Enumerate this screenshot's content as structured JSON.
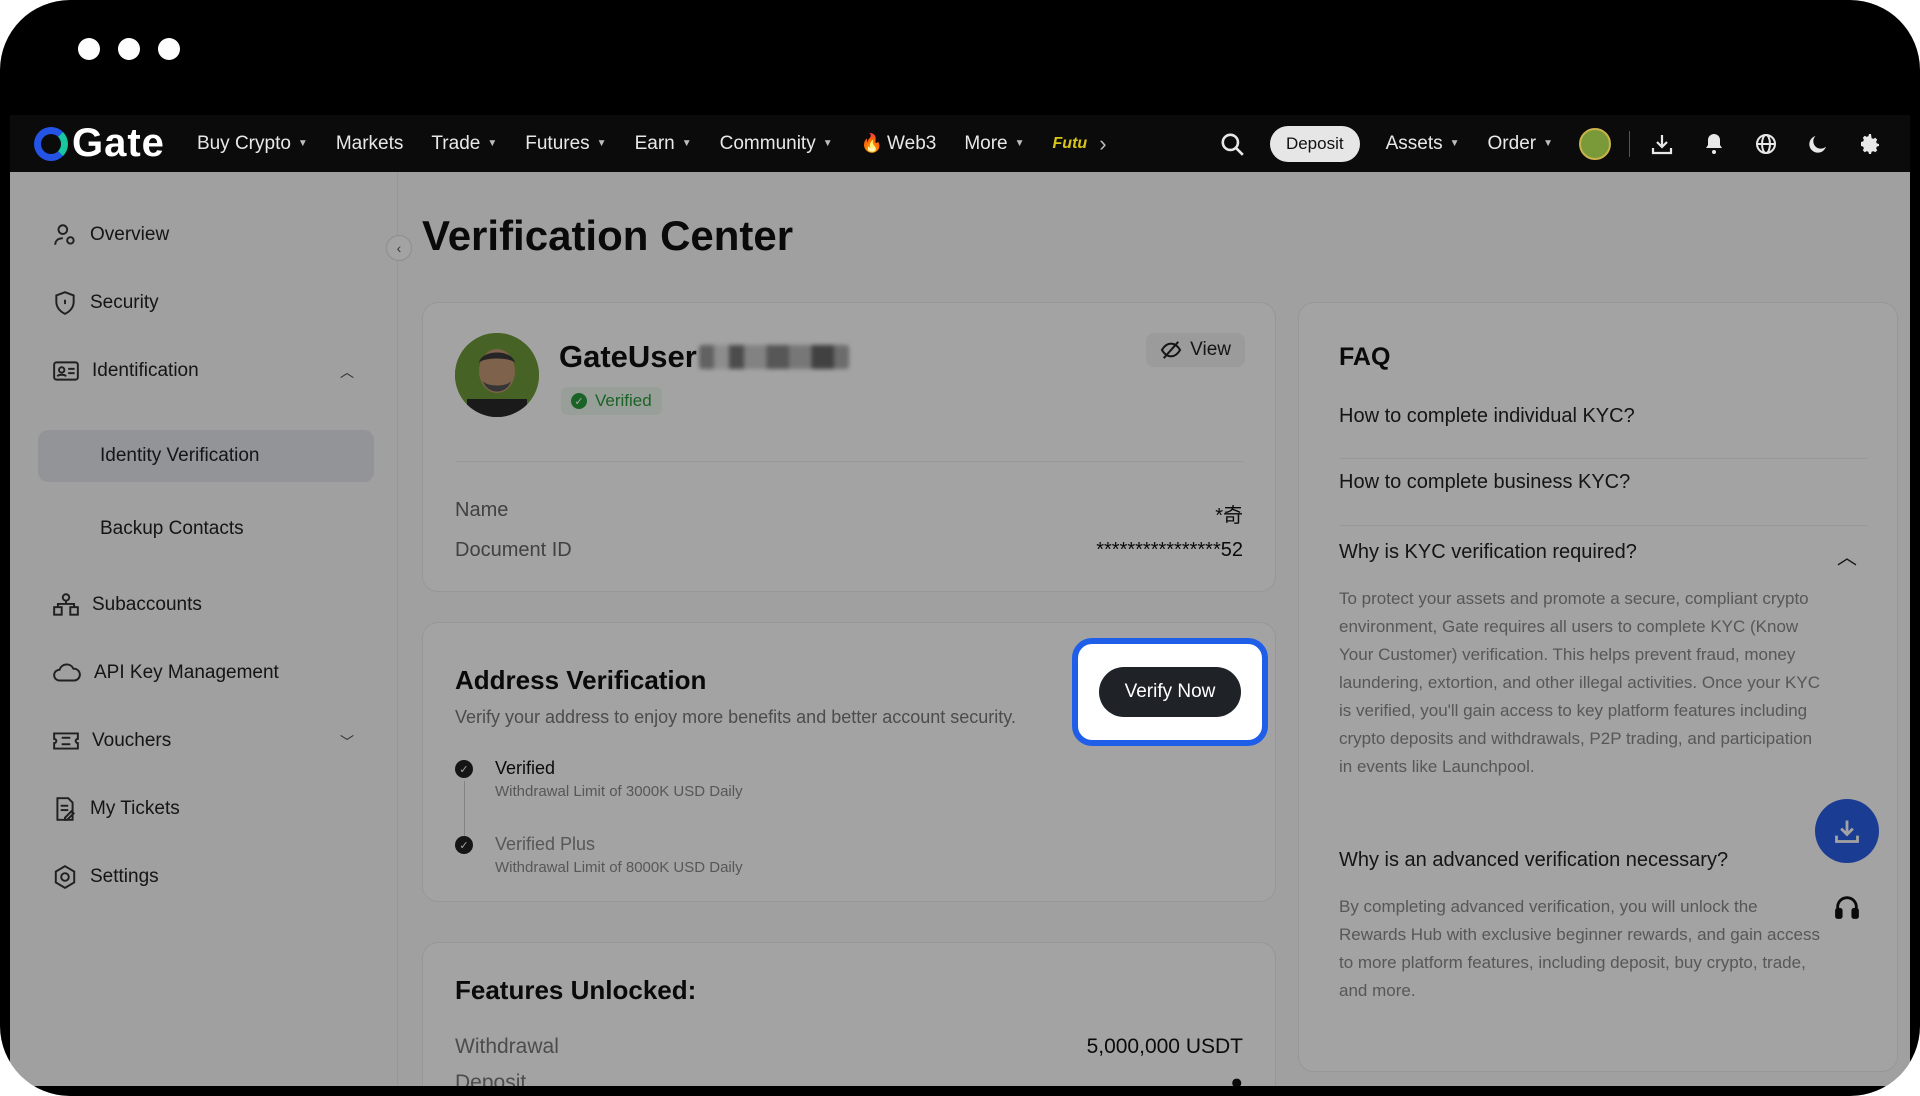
{
  "nav": {
    "logo": "Gate",
    "items": [
      {
        "label": "Buy Crypto",
        "caret": true
      },
      {
        "label": "Markets",
        "caret": false
      },
      {
        "label": "Trade",
        "caret": true
      },
      {
        "label": "Futures",
        "caret": true
      },
      {
        "label": "Earn",
        "caret": true
      },
      {
        "label": "Community",
        "caret": true
      },
      {
        "label": "Web3",
        "caret": false
      },
      {
        "label": "More",
        "caret": true
      }
    ],
    "fut_badge": "Futu",
    "deposit": "Deposit",
    "assets": "Assets",
    "order": "Order"
  },
  "sidebar": {
    "overview": "Overview",
    "security": "Security",
    "identification": "Identification",
    "identity_verification": "Identity Verification",
    "backup_contacts": "Backup Contacts",
    "subaccounts": "Subaccounts",
    "api_key": "API Key Management",
    "vouchers": "Vouchers",
    "my_tickets": "My Tickets",
    "settings": "Settings"
  },
  "page": {
    "title": "Verification Center"
  },
  "profile": {
    "username": "GateUser",
    "status": "Verified",
    "view": "View",
    "name_label": "Name",
    "name_value": "*奇",
    "doc_label": "Document ID",
    "doc_value": "****************52"
  },
  "address": {
    "title": "Address Verification",
    "desc": "Verify your address to enjoy more benefits and better account security.",
    "verify_btn": "Verify Now",
    "step1_title": "Verified",
    "step1_desc": "Withdrawal Limit of 3000K USD Daily",
    "step2_title": "Verified Plus",
    "step2_desc": "Withdrawal Limit of 8000K USD Daily"
  },
  "features": {
    "title": "Features Unlocked:",
    "row1_label": "Withdrawal",
    "row1_value": "5,000,000 USDT",
    "row2_label": "Deposit"
  },
  "faq": {
    "title": "FAQ",
    "q1": "How to complete individual KYC?",
    "q2": "How to complete business KYC?",
    "q3": "Why is KYC verification required?",
    "a3": "To protect your assets and promote a secure, compliant crypto environment, Gate requires all users to complete KYC (Know Your Customer) verification. This helps prevent fraud, money laundering, extortion, and other illegal activities. Once your KYC is verified, you'll gain access to key platform features including crypto deposits and withdrawals, P2P trading, and participation in events like Launchpool.",
    "q4": "Why is an advanced verification necessary?",
    "a4": "By completing advanced verification, you will unlock the Rewards Hub with exclusive beginner rewards, and gain access to more platform features, including deposit, buy crypto, trade, and more."
  },
  "colors": {
    "accent": "#1f5ee8",
    "verified_green": "#2a9b3c",
    "nav_bg": "#0b0b0b"
  }
}
